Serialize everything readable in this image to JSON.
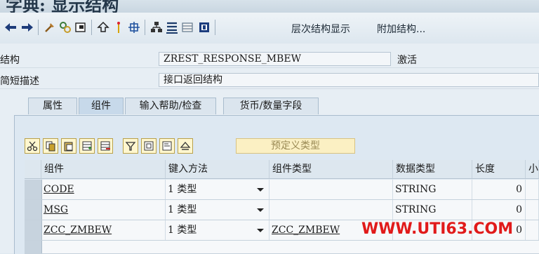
{
  "window": {
    "title": "字典: 显示结构"
  },
  "toolbar": {
    "icons": [
      "back-arrow-icon",
      "forward-arrow-icon",
      "other-object-icon",
      "display-change-icon",
      "activate-icon",
      "check-icon",
      "where-used-icon",
      "navigate-icon",
      "hierarchy-icon",
      "list-icon",
      "layout-icon",
      "info-icon"
    ],
    "hierarchy_label": "层次结构显示",
    "append_label": "附加结构..."
  },
  "header": {
    "structure_label": "结构",
    "structure_value": "ZREST_RESPONSE_MBEW",
    "status": "激活",
    "short_desc_label": "简短描述",
    "short_desc_value": "接口返回结构"
  },
  "tabs": [
    {
      "label": "属性",
      "active": false
    },
    {
      "label": "组件",
      "active": true
    },
    {
      "label": "输入帮助/检查",
      "active": false
    },
    {
      "label": "货币/数量字段",
      "active": false
    }
  ],
  "table_toolbar": {
    "icons": [
      "cut-icon",
      "copy-icon",
      "paste-icon",
      "insert-row-icon",
      "delete-row-icon",
      "filter-icon",
      "select-icon",
      "details-icon",
      "sort-icon"
    ],
    "predefined_type_label": "预定义类型"
  },
  "table": {
    "columns": [
      "组件",
      "键入方法",
      "组件类型",
      "数据类型",
      "长度",
      "小"
    ],
    "rows": [
      {
        "component": "CODE",
        "typing": "1 类型",
        "comp_type": "",
        "data_type": "STRING",
        "length": "0"
      },
      {
        "component": "MSG",
        "typing": "1 类型",
        "comp_type": "",
        "data_type": "STRING",
        "length": "0"
      },
      {
        "component": "ZCC_ZMBEW",
        "typing": "1 类型",
        "comp_type": "ZCC_ZMBEW",
        "data_type": "",
        "length": "0"
      }
    ]
  },
  "watermark": "WWW.UTI63.COM"
}
